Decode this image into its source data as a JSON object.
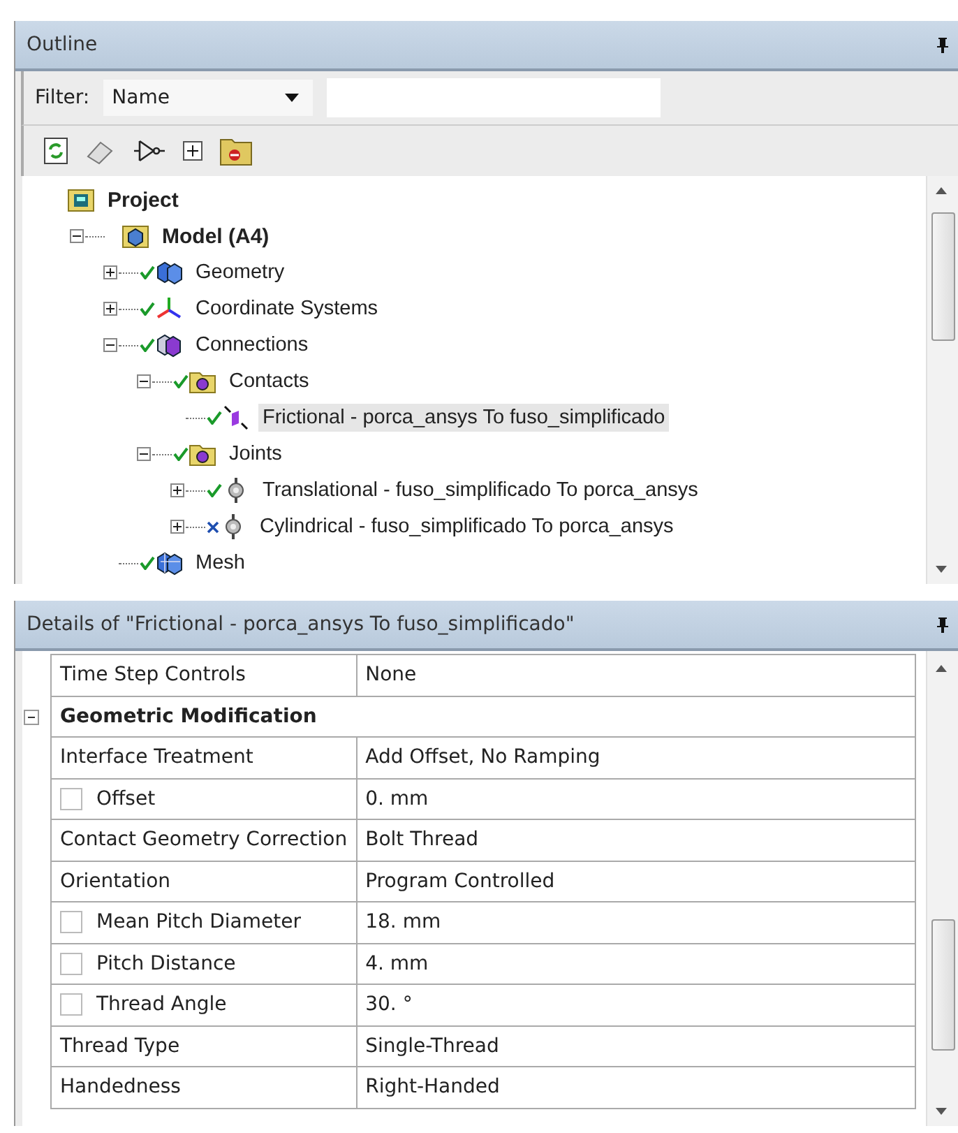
{
  "outline": {
    "title": "Outline",
    "filter": {
      "label": "Filter:",
      "value": "Name"
    },
    "tree": [
      {
        "label": "Project",
        "kind": "project",
        "bold": true,
        "children": [
          {
            "label": "Model (A4)",
            "kind": "model",
            "bold": true,
            "expanded": true,
            "children": [
              {
                "label": "Geometry",
                "kind": "geometry",
                "valid": true,
                "expanded": false
              },
              {
                "label": "Coordinate Systems",
                "kind": "coordinates",
                "valid": true,
                "expanded": false
              },
              {
                "label": "Connections",
                "kind": "connections",
                "valid": true,
                "expanded": true,
                "children": [
                  {
                    "label": "Contacts",
                    "kind": "folder",
                    "valid": true,
                    "expanded": true,
                    "children": [
                      {
                        "label": "Frictional - porca_ansys To fuso_simplificado",
                        "kind": "contact",
                        "valid": true,
                        "selected": true
                      }
                    ]
                  },
                  {
                    "label": "Joints",
                    "kind": "folder",
                    "valid": true,
                    "expanded": true,
                    "children": [
                      {
                        "label": "Translational - fuso_simplificado To porca_ansys",
                        "kind": "joint",
                        "valid": true,
                        "expanded": false
                      },
                      {
                        "label": "Cylindrical - fuso_simplificado To porca_ansys",
                        "kind": "joint",
                        "valid": false,
                        "expanded": false
                      }
                    ]
                  }
                ]
              },
              {
                "label": "Mesh",
                "kind": "mesh",
                "valid": true
              }
            ]
          }
        ]
      }
    ]
  },
  "details": {
    "title": "Details of \"Frictional - porca_ansys To fuso_simplificado\"",
    "rows": [
      {
        "kind": "property",
        "name": "Time Step Controls",
        "value": "None"
      },
      {
        "kind": "group",
        "name": "Geometric Modification",
        "expanded": true
      },
      {
        "kind": "property",
        "name": "Interface Treatment",
        "value": "Add Offset, No Ramping"
      },
      {
        "kind": "parameter",
        "name": "Offset",
        "value": "0. mm",
        "checked": false
      },
      {
        "kind": "property",
        "name": "Contact Geometry Correction",
        "value": "Bolt Thread"
      },
      {
        "kind": "property",
        "name": "Orientation",
        "value": "Program Controlled"
      },
      {
        "kind": "parameter",
        "name": "Mean Pitch Diameter",
        "value": "18. mm",
        "checked": false
      },
      {
        "kind": "parameter",
        "name": "Pitch Distance",
        "value": "4. mm",
        "checked": false
      },
      {
        "kind": "parameter",
        "name": "Thread Angle",
        "value": "30. °",
        "checked": false
      },
      {
        "kind": "property",
        "name": "Thread Type",
        "value": "Single-Thread"
      },
      {
        "kind": "property",
        "name": "Handedness",
        "value": "Right-Handed"
      }
    ]
  }
}
